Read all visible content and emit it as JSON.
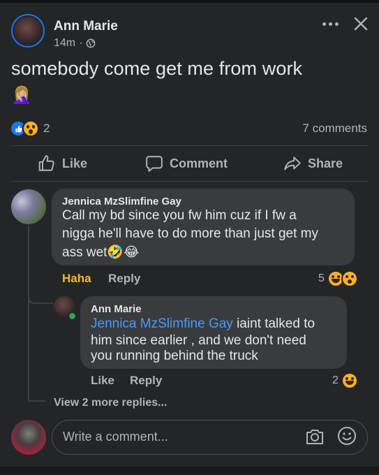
{
  "post": {
    "author": "Ann Marie",
    "time": "14m",
    "text": "somebody come get me from work",
    "emoji": "🤦🏼‍♀️",
    "reaction_count": "2",
    "comments_count": "7 comments",
    "reaction_icons": [
      "like-icon",
      "wow-icon"
    ]
  },
  "actions": {
    "like": "Like",
    "comment": "Comment",
    "share": "Share"
  },
  "comments": [
    {
      "author": "Jennica MzSlimfine Gay",
      "lines": [
        "Call my bd since you fw him cuz if I fw a",
        "nigga he'll have to do more than just get my",
        "ass wet🤣😂"
      ],
      "actions": {
        "haha": "Haha",
        "reply": "Reply"
      },
      "reaction_count": "5"
    }
  ],
  "reply": {
    "author": "Ann Marie",
    "mention": "Jennica MzSlimfine Gay",
    "line1_rest": " iaint talked to",
    "line2": "him since earlier , and we don't need",
    "line3": "you running behind the truck",
    "actions": {
      "like": "Like",
      "reply": "Reply"
    },
    "reaction_count": "2"
  },
  "view_more": "View 2 more replies...",
  "composer": {
    "placeholder": "Write a comment..."
  },
  "colors": {
    "accent": "#1877f2",
    "mention": "#4599ff",
    "haha": "#f7b928",
    "background": "#242526"
  }
}
